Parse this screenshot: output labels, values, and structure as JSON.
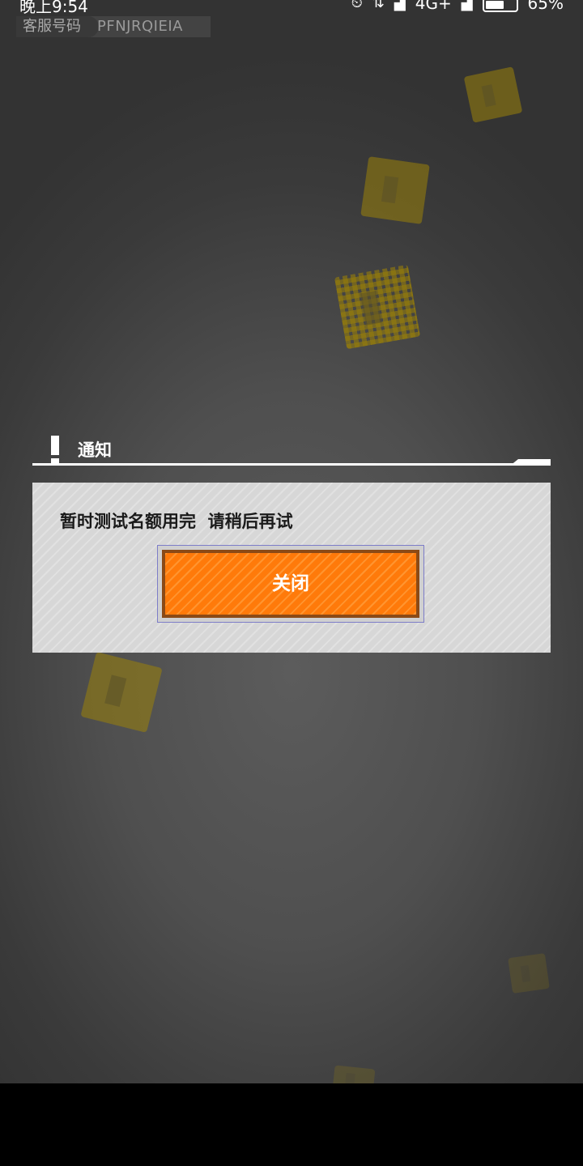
{
  "status_bar": {
    "time": "晚上9:54",
    "network": "4G+",
    "battery": "65%",
    "icons": [
      "alarm-icon",
      "data-transfer-icon",
      "signal-icon",
      "signal-icon-2",
      "battery-icon"
    ]
  },
  "service": {
    "label": "客服号码",
    "code": "PFNJRQIEIA"
  },
  "dialog": {
    "title": "通知",
    "message": "暂时测试名额用完  请稍后再试",
    "close_label": "关闭",
    "icon": "exclamation-icon"
  },
  "colors": {
    "accent": "#ff7a0a",
    "button_border": "#8b4a16",
    "dialog_bg": "#d7d7d7"
  }
}
